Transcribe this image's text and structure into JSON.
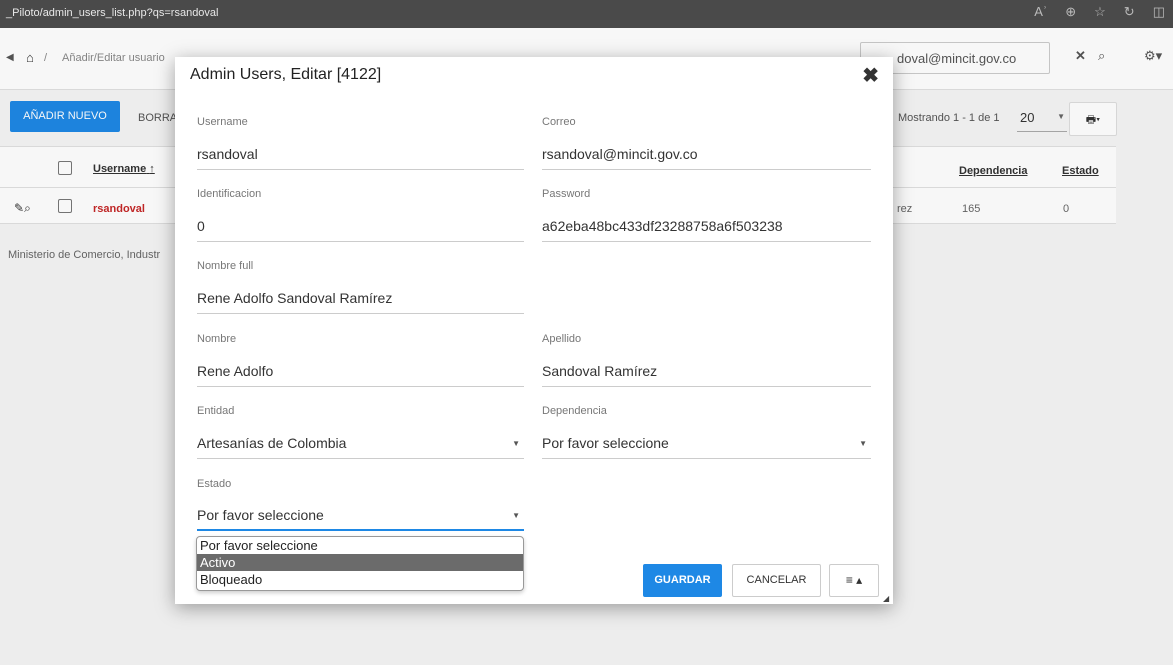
{
  "browser": {
    "url": "_Piloto/admin_users_list.php?qs=rsandoval",
    "read_aloud_label": "Aʾ",
    "zoom_icon": "zoom-icon",
    "favorite_icon": "favorite-star-icon",
    "refresh_icon": "refresh-icon",
    "split_icon": "split-screen-icon"
  },
  "toolbar": {
    "breadcrumb_separator": "/",
    "breadcrumb_page": "Añadir/Editar usuario",
    "search_value": "rsandoval@mincit.gov.co",
    "search_visible_text": "doval@mincit.gov.co",
    "gear_caret": "▾"
  },
  "list": {
    "add_button": "AÑADIR NUEVO",
    "delete_button": "BORRA",
    "showing_text": "Mostrando 1 - 1 de 1",
    "page_size": "20",
    "columns": {
      "username": "Username",
      "sort_indicator": "↑",
      "dependencia": "Dependencia",
      "estado": "Estado"
    },
    "row": {
      "username": "rsandoval",
      "nombre_tail": "rez",
      "dependencia": "165",
      "estado": "0"
    },
    "footer": "Ministerio de Comercio, Industr"
  },
  "modal": {
    "title": "Admin Users, Editar [4122]",
    "fields": {
      "username": {
        "label": "Username",
        "value": "rsandoval"
      },
      "correo": {
        "label": "Correo",
        "value": "rsandoval@mincit.gov.co"
      },
      "identificacion": {
        "label": "Identificacion",
        "value": "0"
      },
      "password": {
        "label": "Password",
        "value": "a62eba48bc433df23288758a6f503238"
      },
      "nombre_full": {
        "label": "Nombre full",
        "value": "Rene Adolfo Sandoval Ramírez"
      },
      "nombre": {
        "label": "Nombre",
        "value": "Rene Adolfo"
      },
      "apellido": {
        "label": "Apellido",
        "value": "Sandoval Ramírez"
      },
      "entidad": {
        "label": "Entidad",
        "value": "Artesanías de Colombia"
      },
      "dependencia": {
        "label": "Dependencia",
        "value": "Por favor seleccione"
      },
      "estado": {
        "label": "Estado",
        "value": "Por favor seleccione"
      }
    },
    "estado_options": [
      "Por favor seleccione",
      "Activo",
      "Bloqueado"
    ],
    "estado_highlighted": "Activo",
    "save_button": "GUARDAR",
    "cancel_button": "CANCELAR",
    "more_button": "≡ ▴"
  }
}
